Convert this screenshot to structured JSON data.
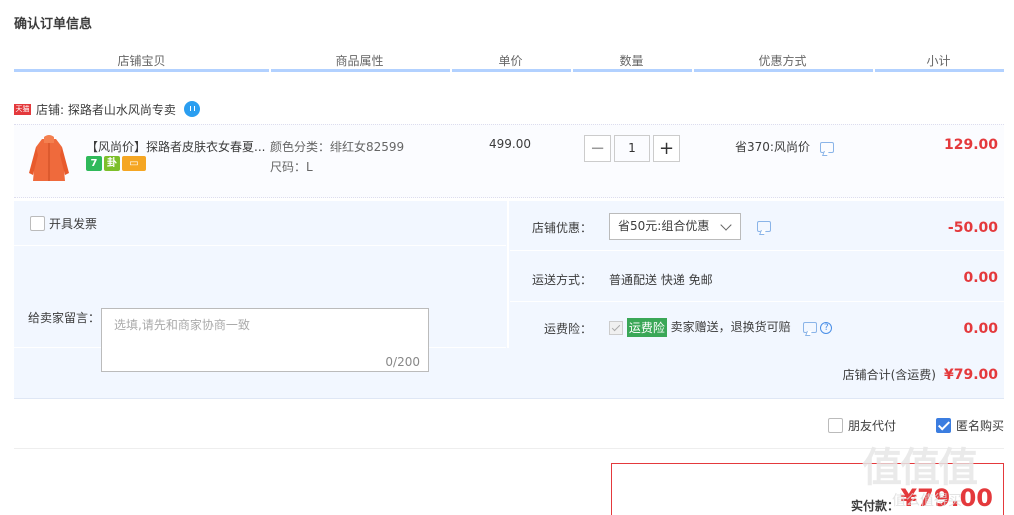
{
  "page": {
    "title": "确认订单信息"
  },
  "columns": [
    "店铺宝贝",
    "商品属性",
    "单价",
    "数量",
    "优惠方式",
    "小计"
  ],
  "shop": {
    "badge": "天猫",
    "name": "店铺: 探路者山水风尚专卖"
  },
  "item": {
    "title": "【风尚价】探路者皮肤衣女春夏...",
    "color_attr": "颜色分类：绯红女82599",
    "size_attr": "尺码：L",
    "unit_price": "499.00",
    "quantity": "1",
    "minus": "−",
    "plus": "+",
    "discount": "省370:风尚价",
    "subtotal": "129.00",
    "service_icons": [
      "7",
      "卦",
      "card"
    ]
  },
  "invoice": {
    "label": "开具发票"
  },
  "message": {
    "label": "给卖家留言：",
    "placeholder": "选填,请先和商家协商一致",
    "count": "0/200"
  },
  "shop_discount": {
    "label": "店铺优惠：",
    "selected": "省50元:组合优惠",
    "value": "-50.00"
  },
  "shipping": {
    "label": "运送方式：",
    "method": "普通配送 快递 免邮",
    "value": "0.00"
  },
  "insurance": {
    "label": "运费险：",
    "badge": "运费险",
    "text": "卖家赠送，退换货可赔",
    "value": "0.00"
  },
  "shop_total": {
    "label": "店铺合计(含运费)",
    "value": "¥79.00"
  },
  "options": {
    "friend_pay": "朋友代付",
    "anonymous": "匿名购买"
  },
  "payment": {
    "label": "实付款：",
    "value": "¥79.00"
  },
  "watermark": {
    "text": "值值值",
    "url": "值么值得买"
  },
  "colors": {
    "accent_red": "#e4393c",
    "header_line": "#b2d1ff",
    "panel_bg": "#f2f7ff"
  }
}
